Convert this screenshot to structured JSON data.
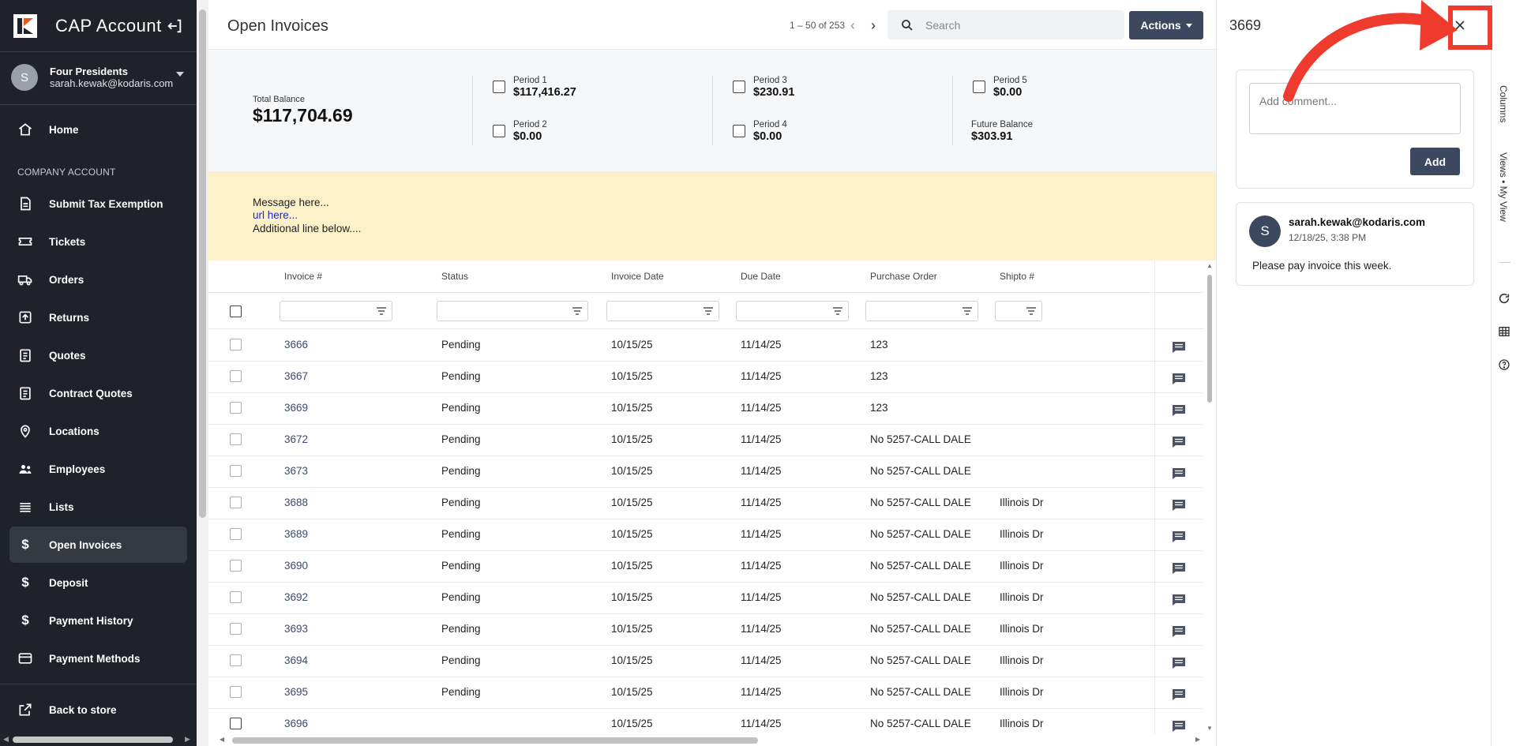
{
  "app": {
    "title": "CAP Account"
  },
  "account": {
    "avatar_initial": "S",
    "name": "Four Presidents",
    "email": "sarah.kewak@kodaris.com"
  },
  "sidebar": {
    "home": "Home",
    "section_label": "COMPANY ACCOUNT",
    "items": [
      {
        "label": "Submit Tax Exemption",
        "icon": "document-icon"
      },
      {
        "label": "Tickets",
        "icon": "ticket-icon"
      },
      {
        "label": "Orders",
        "icon": "truck-icon"
      },
      {
        "label": "Returns",
        "icon": "return-icon"
      },
      {
        "label": "Quotes",
        "icon": "clipboard-icon"
      },
      {
        "label": "Contract Quotes",
        "icon": "clipboard-icon"
      },
      {
        "label": "Locations",
        "icon": "location-pin-icon"
      },
      {
        "label": "Employees",
        "icon": "people-icon"
      },
      {
        "label": "Lists",
        "icon": "list-icon"
      },
      {
        "label": "Open Invoices",
        "icon": "dollar-icon",
        "active": true
      },
      {
        "label": "Deposit",
        "icon": "dollar-icon"
      },
      {
        "label": "Payment History",
        "icon": "dollar-icon"
      },
      {
        "label": "Payment Methods",
        "icon": "credit-card-icon"
      }
    ],
    "back_to_store": "Back to store"
  },
  "header": {
    "title": "Open Invoices",
    "pagination": "1 – 50 of 253",
    "search_placeholder": "Search",
    "actions_label": "Actions"
  },
  "summary": {
    "total_label": "Total Balance",
    "total_value": "$117,704.69",
    "period1_label": "Period 1",
    "period1_value": "$117,416.27",
    "period2_label": "Period 2",
    "period2_value": "$0.00",
    "period3_label": "Period 3",
    "period3_value": "$230.91",
    "period4_label": "Period 4",
    "period4_value": "$0.00",
    "period5_label": "Period 5",
    "period5_value": "$0.00",
    "future_label": "Future Balance",
    "future_value": "$303.91"
  },
  "message": {
    "line1": "Message here...",
    "link": "url here...",
    "line3": "Additional line below...."
  },
  "table": {
    "columns": [
      "Invoice #",
      "Status",
      "Invoice Date",
      "Due Date",
      "Purchase Order",
      "Shipto #"
    ],
    "rows": [
      {
        "invoice": "3666",
        "status": "Pending",
        "invoice_date": "10/15/25",
        "due_date": "11/14/25",
        "po": "123",
        "shipto": ""
      },
      {
        "invoice": "3667",
        "status": "Pending",
        "invoice_date": "10/15/25",
        "due_date": "11/14/25",
        "po": "123",
        "shipto": ""
      },
      {
        "invoice": "3669",
        "status": "Pending",
        "invoice_date": "10/15/25",
        "due_date": "11/14/25",
        "po": "123",
        "shipto": ""
      },
      {
        "invoice": "3672",
        "status": "Pending",
        "invoice_date": "10/15/25",
        "due_date": "11/14/25",
        "po": "No 5257-CALL DALE",
        "shipto": ""
      },
      {
        "invoice": "3673",
        "status": "Pending",
        "invoice_date": "10/15/25",
        "due_date": "11/14/25",
        "po": "No 5257-CALL DALE",
        "shipto": ""
      },
      {
        "invoice": "3688",
        "status": "Pending",
        "invoice_date": "10/15/25",
        "due_date": "11/14/25",
        "po": "No 5257-CALL DALE",
        "shipto": "Illinois Dr"
      },
      {
        "invoice": "3689",
        "status": "Pending",
        "invoice_date": "10/15/25",
        "due_date": "11/14/25",
        "po": "No 5257-CALL DALE",
        "shipto": "Illinois Dr"
      },
      {
        "invoice": "3690",
        "status": "Pending",
        "invoice_date": "10/15/25",
        "due_date": "11/14/25",
        "po": "No 5257-CALL DALE",
        "shipto": "Illinois Dr"
      },
      {
        "invoice": "3692",
        "status": "Pending",
        "invoice_date": "10/15/25",
        "due_date": "11/14/25",
        "po": "No 5257-CALL DALE",
        "shipto": "Illinois Dr"
      },
      {
        "invoice": "3693",
        "status": "Pending",
        "invoice_date": "10/15/25",
        "due_date": "11/14/25",
        "po": "No 5257-CALL DALE",
        "shipto": "Illinois Dr"
      },
      {
        "invoice": "3694",
        "status": "Pending",
        "invoice_date": "10/15/25",
        "due_date": "11/14/25",
        "po": "No 5257-CALL DALE",
        "shipto": "Illinois Dr"
      },
      {
        "invoice": "3695",
        "status": "Pending",
        "invoice_date": "10/15/25",
        "due_date": "11/14/25",
        "po": "No 5257-CALL DALE",
        "shipto": "Illinois Dr"
      },
      {
        "invoice": "3696",
        "status": "",
        "invoice_date": "10/15/25",
        "due_date": "11/14/25",
        "po": "No 5257-CALL DALE",
        "shipto": "Illinois Dr"
      }
    ]
  },
  "panel": {
    "title": "3669",
    "comment_placeholder": "Add comment...",
    "add_label": "Add",
    "comment": {
      "avatar_initial": "S",
      "author": "sarah.kewak@kodaris.com",
      "date": "12/18/25, 3:38 PM",
      "text": "Please pay invoice this week."
    }
  },
  "right_toolbar": {
    "columns_label": "Columns",
    "views_label": "Views • My View"
  },
  "colors": {
    "sidebar": "#1f2329",
    "accent": "#3c4860",
    "message_bg": "#fdf1c9",
    "annotation": "#ef3b2d"
  }
}
